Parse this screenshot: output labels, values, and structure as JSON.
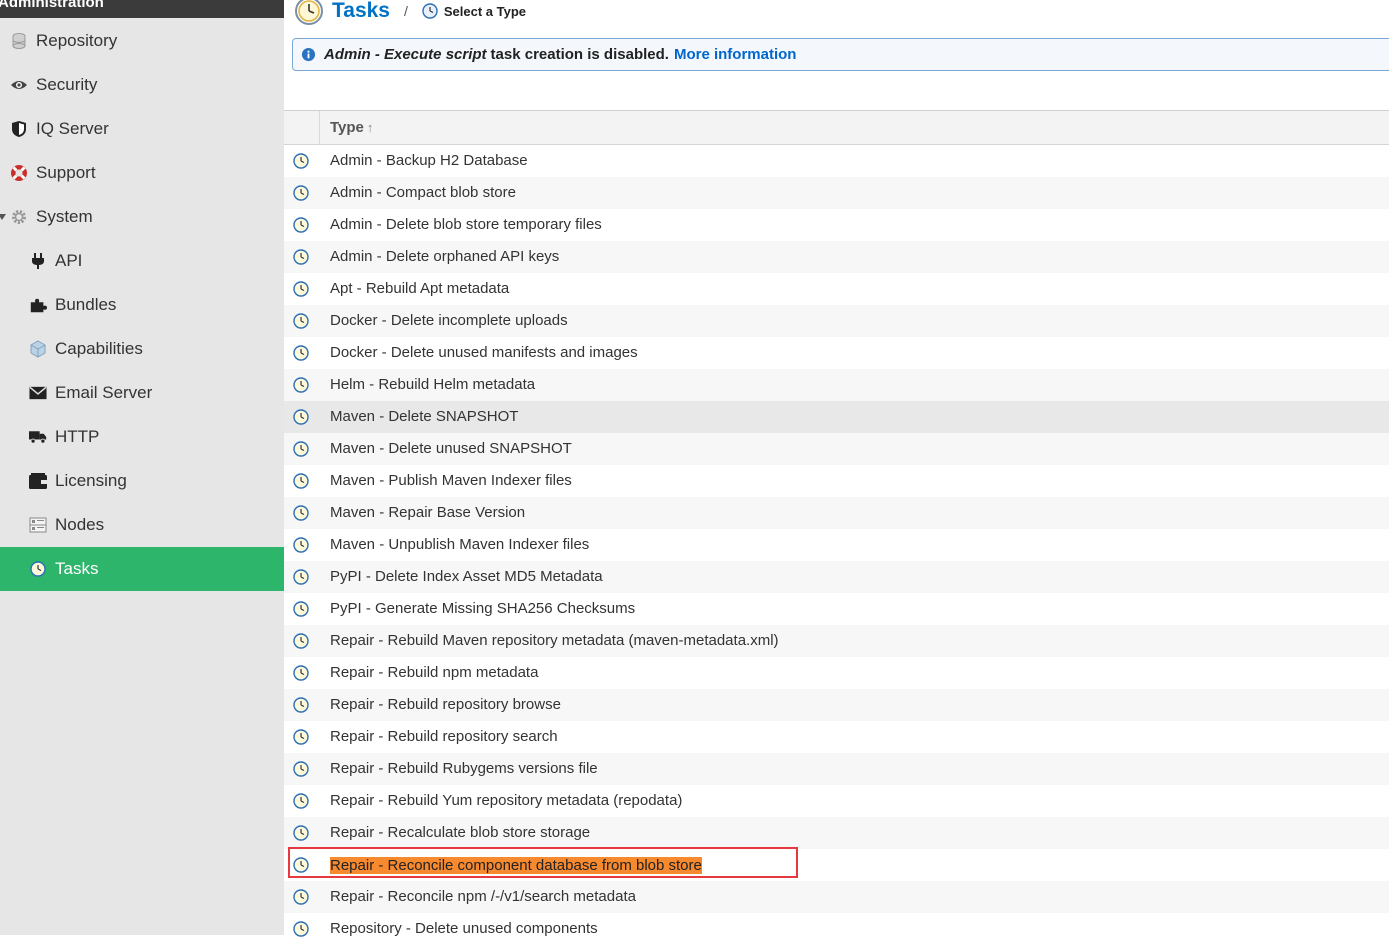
{
  "sidebar": {
    "header": "Administration",
    "items": [
      {
        "label": "Repository",
        "icon": "database-icon",
        "level": 1
      },
      {
        "label": "Security",
        "icon": "eye-icon",
        "level": 1
      },
      {
        "label": "IQ Server",
        "icon": "shield-icon",
        "level": 1
      },
      {
        "label": "Support",
        "icon": "lifebuoy-icon",
        "level": 1
      },
      {
        "label": "System",
        "icon": "gear-icon",
        "level": 1,
        "expanded": true
      },
      {
        "label": "API",
        "icon": "plug-icon",
        "level": 2
      },
      {
        "label": "Bundles",
        "icon": "puzzle-icon",
        "level": 2
      },
      {
        "label": "Capabilities",
        "icon": "cube-icon",
        "level": 2
      },
      {
        "label": "Email Server",
        "icon": "envelope-icon",
        "level": 2
      },
      {
        "label": "HTTP",
        "icon": "truck-icon",
        "level": 2
      },
      {
        "label": "Licensing",
        "icon": "wallet-icon",
        "level": 2
      },
      {
        "label": "Nodes",
        "icon": "server-icon",
        "level": 2
      },
      {
        "label": "Tasks",
        "icon": "clock-icon",
        "level": 2,
        "active": true
      }
    ]
  },
  "breadcrumb": {
    "title": "Tasks",
    "separator": "/",
    "subtitle": "Select a Type"
  },
  "notice": {
    "emphasis": "Admin - Execute script",
    "text": "task creation is disabled.",
    "link": "More information"
  },
  "grid": {
    "column_header": "Type",
    "sort_indicator": "↑",
    "rows": [
      "Admin - Backup H2 Database",
      "Admin - Compact blob store",
      "Admin - Delete blob store temporary files",
      "Admin - Delete orphaned API keys",
      "Apt - Rebuild Apt metadata",
      "Docker - Delete incomplete uploads",
      "Docker - Delete unused manifests and images",
      "Helm - Rebuild Helm metadata",
      "Maven - Delete SNAPSHOT",
      "Maven - Delete unused SNAPSHOT",
      "Maven - Publish Maven Indexer files",
      "Maven - Repair Base Version",
      "Maven - Unpublish Maven Indexer files",
      "PyPI - Delete Index Asset MD5 Metadata",
      "PyPI - Generate Missing SHA256 Checksums",
      "Repair - Rebuild Maven repository metadata (maven-metadata.xml)",
      "Repair - Rebuild npm metadata",
      "Repair - Rebuild repository browse",
      "Repair - Rebuild repository search",
      "Repair - Rebuild Rubygems versions file",
      "Repair - Rebuild Yum repository metadata (repodata)",
      "Repair - Recalculate blob store storage",
      "Repair - Reconcile component database from blob store",
      "Repair - Reconcile npm /-/v1/search metadata",
      "Repository - Delete unused components"
    ],
    "hovered_row": "Maven - Delete SNAPSHOT",
    "highlighted_row": "Repair - Reconcile component database from blob store"
  },
  "colors": {
    "active_nav": "#2db56c",
    "link": "#0072c6",
    "highlight_text_bg": "#f7892f",
    "highlight_border": "#e5393f"
  }
}
